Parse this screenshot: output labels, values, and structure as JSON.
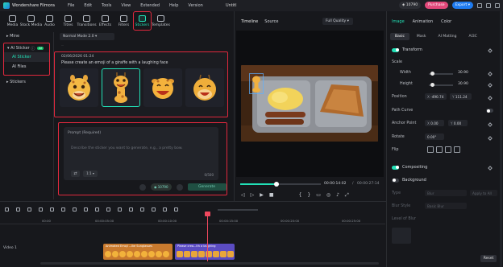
{
  "titlebar": {
    "app_name": "Wondershare Filmora",
    "menu": [
      "File",
      "Edit",
      "Tools",
      "View",
      "Extended",
      "Help",
      "Version"
    ],
    "project_title": "Untitl",
    "credits": "10790",
    "purchase_label": "Purchase",
    "export_label": "Export"
  },
  "toolbar": {
    "items": [
      {
        "label": "Media",
        "icon": "media-icon"
      },
      {
        "label": "Stock Media",
        "icon": "stock-media-icon"
      },
      {
        "label": "Audio",
        "icon": "audio-icon"
      },
      {
        "label": "Titles",
        "icon": "titles-icon"
      },
      {
        "label": "Transitions",
        "icon": "transitions-icon"
      },
      {
        "label": "Effects",
        "icon": "effects-icon"
      },
      {
        "label": "Filters",
        "icon": "filters-icon"
      },
      {
        "label": "Stickers",
        "icon": "stickers-icon",
        "active": true
      },
      {
        "label": "Templates",
        "icon": "templates-icon"
      }
    ]
  },
  "sidebar": {
    "mine": "Mine",
    "ai_sticker_group": "AI Sticker",
    "badge": "AI",
    "ai_sticker": "AI Sticker",
    "ai_files": "AI Files",
    "stickers": "Stickers"
  },
  "main": {
    "mode": "Normal Mode 2.0",
    "note": "...",
    "result_date": "02/06/2026 01:24",
    "result_prompt": "Please create an emoji of a giraffe with a laughing face",
    "prompt_label": "Prompt (Required)",
    "prompt_placeholder": "Describe the sticker you want to generate, e.g., a pretty bow.",
    "char_count": "0/500",
    "ratio": "1:1",
    "gen_credits": "10790",
    "generate_label": "Generate"
  },
  "player": {
    "tab_timeline": "Timeline",
    "tab_source": "Source",
    "quality": "Full Quality",
    "current_time": "00:00:14:02",
    "total_time": "00:00:27:14",
    "progress": 0.45
  },
  "inspector": {
    "tabs": [
      "Image",
      "Animation",
      "Color"
    ],
    "sub_tabs": [
      "Basic",
      "Mask",
      "AI Matting",
      "AI3C"
    ],
    "transform": "Transform",
    "scale": "Scale",
    "width_label": "Width",
    "width_value": "30.90",
    "height_label": "Height",
    "height_value": "30.90",
    "position_label": "Position",
    "pos_x": "-490.74",
    "pos_y": "111.24",
    "path_curve": "Path Curve",
    "anchor_label": "Anchor Point",
    "anchor_x": "0.00",
    "anchor_y": "0.00",
    "rotate_label": "Rotate",
    "rotate_value": "0.00°",
    "flip_label": "Flip",
    "compositing": "Compositing",
    "background": "Background",
    "type_label": "Type",
    "type_value": "Blur",
    "apply_all": "Apply to All",
    "blur_style_label": "Blur Style",
    "blur_style_value": "Basic Blur",
    "level_label": "Level of Blur",
    "reset_label": "Reset"
  },
  "timeline": {
    "ticks": [
      "00:00",
      "00:00:05:00",
      "00:00:10:00",
      "00:00:15:00",
      "00:00:20:00",
      "00:00:25:00"
    ],
    "clip1_title": "Animated Emoji ...ike Sunglasses",
    "clip2_title": "Please crea...ith a laughing",
    "track_label": "Video 1"
  },
  "colors": {
    "accent": "#22e0b6",
    "highlight": "#e0283d",
    "purchase": "#e2487a",
    "export": "#1e7bf0",
    "clip1": "#c97a2e",
    "clip2": "#5b4cc2"
  }
}
